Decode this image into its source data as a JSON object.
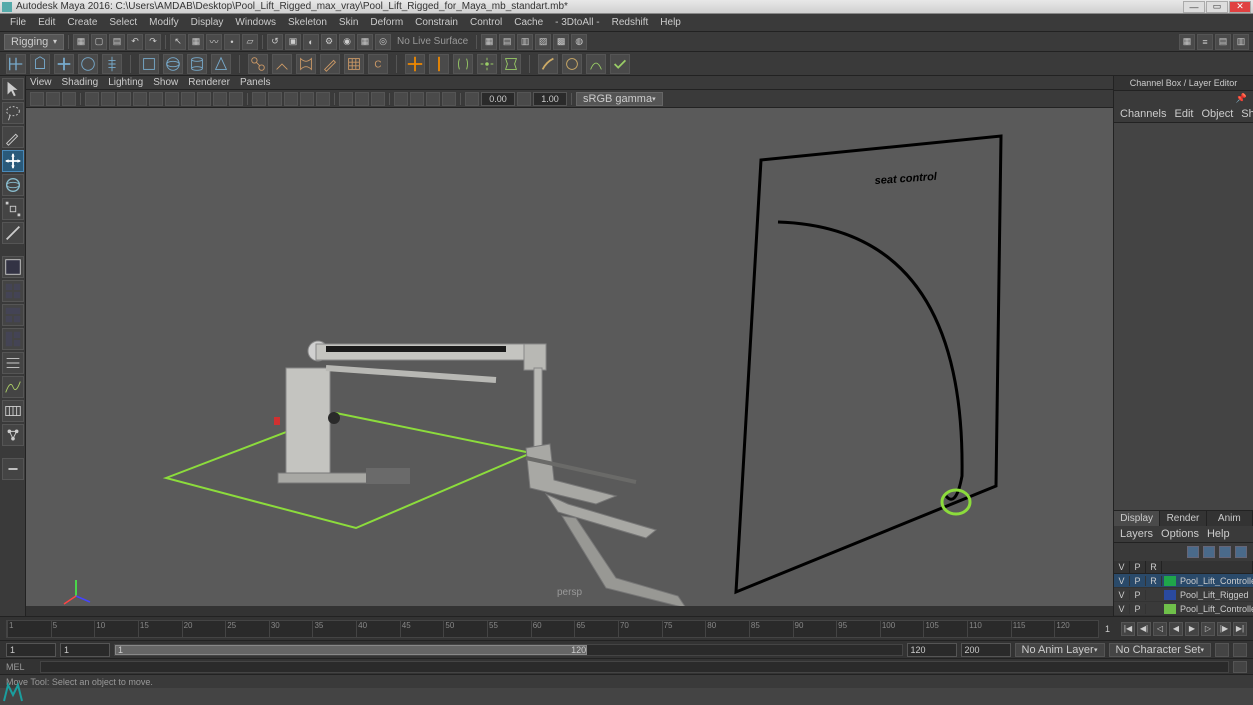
{
  "title": "Autodesk Maya 2016: C:\\Users\\AMDAB\\Desktop\\Pool_Lift_Rigged_max_vray\\Pool_Lift_Rigged_for_Maya_mb_standart.mb*",
  "menu": [
    "File",
    "Edit",
    "Create",
    "Select",
    "Modify",
    "Display",
    "Windows",
    "Skeleton",
    "Skin",
    "Deform",
    "Constrain",
    "Control",
    "Cache",
    "- 3DtoAll -",
    "Redshift",
    "Help"
  ],
  "mode_combo": "Rigging",
  "no_live_surface": "No Live Surface",
  "view_menu": [
    "View",
    "Shading",
    "Lighting",
    "Show",
    "Renderer",
    "Panels"
  ],
  "view_num1": "0.00",
  "view_num2": "1.00",
  "view_colorspace": "sRGB gamma",
  "viewport": {
    "label": "persp",
    "annotation": "seat control"
  },
  "right": {
    "title": "Channel Box / Layer Editor",
    "tabs": [
      "Channels",
      "Edit",
      "Object",
      "Show"
    ],
    "tabs2": [
      "Display",
      "Render",
      "Anim"
    ],
    "sub": [
      "Layers",
      "Options",
      "Help"
    ],
    "cols": [
      "V",
      "P",
      "R"
    ],
    "layers": [
      {
        "v": "V",
        "p": "P",
        "r": "R",
        "color": "#1fa64a",
        "name": "Pool_Lift_Controllers_l",
        "sel": true
      },
      {
        "v": "V",
        "p": "P",
        "r": "",
        "color": "#2a4aa0",
        "name": "Pool_Lift_Rigged",
        "sel": false
      },
      {
        "v": "V",
        "p": "P",
        "r": "",
        "color": "#6fc04a",
        "name": "Pool_Lift_Controllers",
        "sel": false
      }
    ]
  },
  "timeline_ticks": [
    "1",
    "5",
    "10",
    "15",
    "20",
    "25",
    "30",
    "35",
    "40",
    "45",
    "50",
    "55",
    "60",
    "65",
    "70",
    "75",
    "80",
    "85",
    "90",
    "95",
    "100",
    "105",
    "110",
    "115",
    "120"
  ],
  "range": {
    "start": "1",
    "view_start": "1",
    "view_end": "120",
    "end": "120",
    "total": "200"
  },
  "anim_layer": "No Anim Layer",
  "character_set": "No Character Set",
  "cmd_label": "MEL",
  "status_text": "Move Tool: Select an object to move.",
  "range_end_label": "1"
}
